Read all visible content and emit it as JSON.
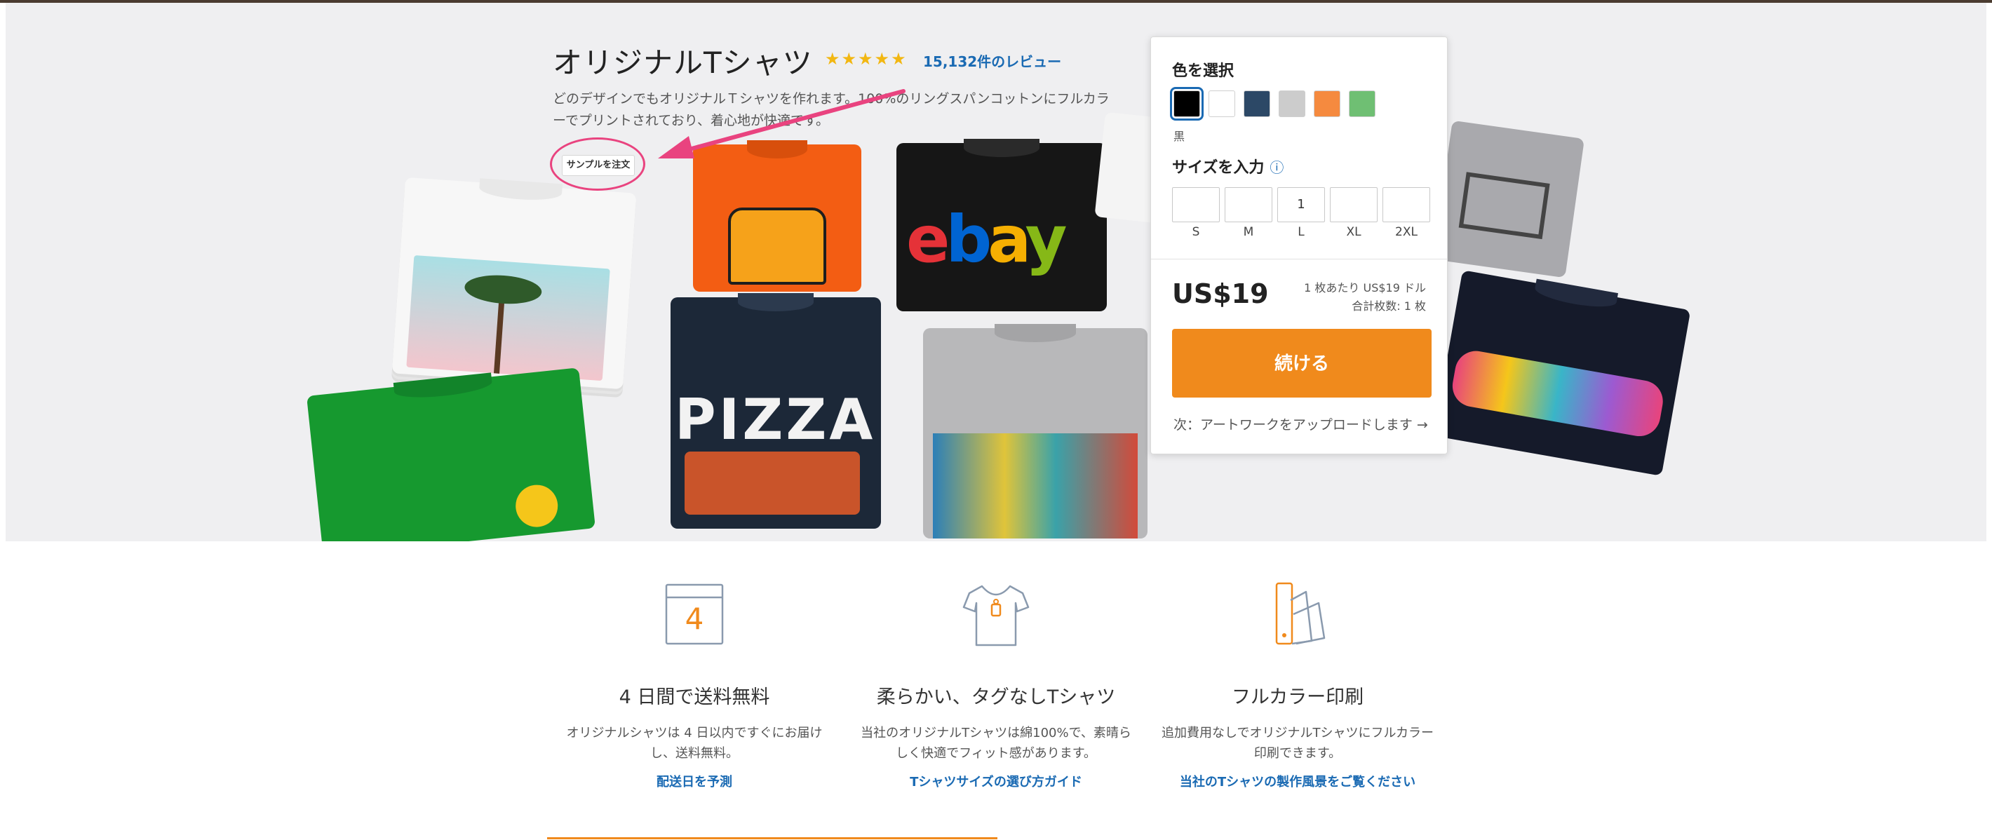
{
  "product": {
    "title": "オリジナルTシャツ",
    "stars": "★★★★★",
    "review_link": "15,132件のレビュー",
    "description": "どのデザインでもオリジナルＴシャツを作れます。100%のリングスパンコットンにフルカラーでプリントされており、着心地が快適です。",
    "sample_button": "サンプルを注文"
  },
  "hero_prints": {
    "ebay": [
      "e",
      "b",
      "a",
      "y"
    ],
    "pizza": "PIZZA"
  },
  "order": {
    "color_label": "色を選択",
    "colors": [
      {
        "name": "黒",
        "hex": "#000000",
        "selected": true
      },
      {
        "name": "白",
        "hex": "#ffffff"
      },
      {
        "name": "ネイビー",
        "hex": "#2c4866"
      },
      {
        "name": "グレー",
        "hex": "#cccccc"
      },
      {
        "name": "オレンジ",
        "hex": "#f58a3f"
      },
      {
        "name": "グリーン",
        "hex": "#6fbf73"
      }
    ],
    "selected_color_name": "黒",
    "size_label": "サイズを入力",
    "info_icon": "ⓘ",
    "sizes": [
      {
        "label": "S",
        "qty": ""
      },
      {
        "label": "M",
        "qty": ""
      },
      {
        "label": "L",
        "qty": "1"
      },
      {
        "label": "XL",
        "qty": ""
      },
      {
        "label": "2XL",
        "qty": ""
      }
    ],
    "price": "US$19",
    "per_unit": "1 枚あたり US$19 ドル",
    "total_count": "合計枚数: 1 枚",
    "continue_button": "続ける",
    "next_step": "次：アートワークをアップロードします →"
  },
  "features": [
    {
      "icon": "calendar-icon",
      "icon_text": "4",
      "title": "4 日間で送料無料",
      "desc": "オリジナルシャツは 4 日以内ですぐにお届けし、送料無料。",
      "link": "配送日を予測"
    },
    {
      "icon": "tshirt-tag-icon",
      "title": "柔らかい、タグなしTシャツ",
      "desc": "当社のオリジナルTシャツは綿100%で、素晴らしく快適でフィット感があります。",
      "link": "Tシャツサイズの選び方ガイド"
    },
    {
      "icon": "color-swatch-icon",
      "title": "フルカラー印刷",
      "desc": "追加費用なしでオリジナルTシャツにフルカラー印刷できます。",
      "link": "当社のTシャツの製作風景をご覧ください"
    }
  ],
  "colors": {
    "accent_orange": "#f08a1c",
    "link_blue": "#1a6ab3",
    "highlight_pink": "#e9437f",
    "star_yellow": "#f2b712"
  }
}
